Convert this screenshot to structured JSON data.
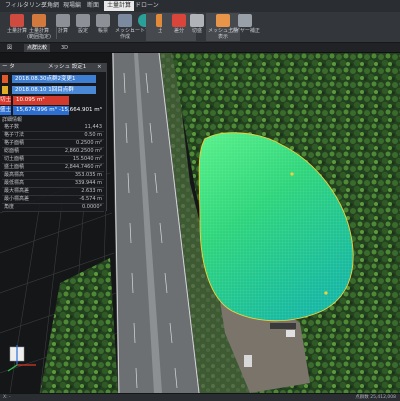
{
  "menu": {
    "items": [
      "フィルタリング",
      "三角網",
      "現場編",
      "断面",
      "土量計算",
      "ドローン"
    ],
    "active_index": 4
  },
  "ribbon": {
    "buttons": [
      {
        "label": "土量計算",
        "icon": "volume-calc-icon",
        "color": "#cf4b40"
      },
      {
        "label": "土量計算\n(範囲指定)",
        "icon": "volume-range-icon",
        "color": "#d27a3e"
      },
      {
        "label": "計算",
        "icon": "calc-icon",
        "color": "#8d9096"
      },
      {
        "label": "設定",
        "icon": "settings-icon",
        "color": "#8d9096"
      },
      {
        "label": "帳票",
        "icon": "report-icon",
        "color": "#8d9096"
      },
      {
        "label": "メッシュ\n作成",
        "icon": "mesh-create-icon",
        "color": "#7c8aa0"
      },
      {
        "label": "ヒートマップ",
        "icon": "heatmap-icon",
        "color": "#2aa198"
      },
      {
        "label": "土量",
        "icon": "volume-icon",
        "color": "#e08a3a"
      },
      {
        "label": "差分",
        "icon": "diff-icon",
        "color": "#d9453a"
      },
      {
        "label": "切盛",
        "icon": "cut-fill-icon",
        "color": "#b0b3b8"
      },
      {
        "label": "メッシュ土量\n表示",
        "icon": "mesh-volume-icon",
        "color": "#e8954a"
      },
      {
        "label": "ワイヤー補正",
        "icon": "wire-correct-icon",
        "color": "#9aa0a8"
      }
    ]
  },
  "tabs": [
    {
      "label": "図",
      "active": false
    },
    {
      "label": "点群比較",
      "active": true
    },
    {
      "label": "3D",
      "active": false
    }
  ],
  "panel": {
    "title_left": "ー タ",
    "title_right": "メッシュ 設定1",
    "close_glyph": "×",
    "rows": [
      {
        "label": "2018.08.30点群2変更1",
        "swatch": "#e05a2a"
      },
      {
        "label": "2018.08.10 1回目点群",
        "swatch": "#e0b02a"
      }
    ],
    "cut": {
      "label": "切土",
      "value": "10.095 m³"
    },
    "fill": {
      "label": "盛土",
      "value": "15,674.996 m³",
      "net": "-15,664.901 m³"
    },
    "detail_title": "詳細情報",
    "details": [
      {
        "label": "格子数",
        "value": "11,443"
      },
      {
        "label": "格子寸法",
        "value": "0.50 m"
      },
      {
        "label": "格子面積",
        "value": "0.2500 m²"
      },
      {
        "label": "総面積",
        "value": "2,860.2500 m²"
      },
      {
        "label": "切土面積",
        "value": "15.5040 m²"
      },
      {
        "label": "盛土面積",
        "value": "2,844.7460 m²"
      },
      {
        "label": "最高標高",
        "value": "353.035 m"
      },
      {
        "label": "最低標高",
        "value": "339.944 m"
      },
      {
        "label": "最大標高差",
        "value": "2.633 m"
      },
      {
        "label": "最小標高差",
        "value": "-6.574 m"
      },
      {
        "label": "角度",
        "value": "0.0000°"
      }
    ]
  },
  "statusbar": {
    "left": "X: -",
    "right": "点群数 25,412,008"
  },
  "colors": {
    "accent_blue": "#3f7fd3",
    "cut_red": "#d8372c",
    "fill_blue": "#2d6fd0",
    "mesh_green": "#32d67a"
  }
}
